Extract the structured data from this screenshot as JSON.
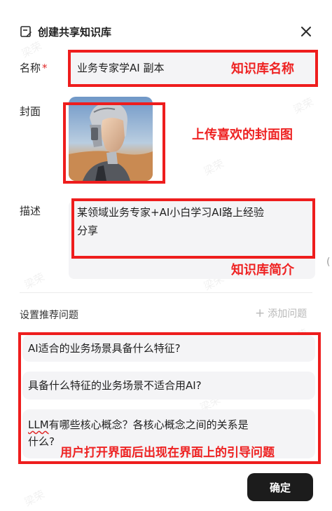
{
  "dialog": {
    "title": "创建共享知识库",
    "close_icon": "close-icon",
    "title_icon": "edit-document-icon"
  },
  "form": {
    "name_label": "名称",
    "required_mark": "*",
    "name_value": "业务专家学AI 副本",
    "cover_label": "封面",
    "description_label": "描述",
    "description_line1": "某领域业务专家+AI小白学习AI路上经验",
    "description_line2": "分享"
  },
  "suggestions": {
    "label": "设置推荐问题",
    "add_label": "添加问题",
    "items": [
      {
        "text": "AI适合的业务场景具备什么特征?"
      },
      {
        "text": "具备什么特征的业务场景不适合用AI?"
      },
      {
        "prefix": "LLM",
        "line1": "有哪些核心概念？各核心概念之间的关系是",
        "line2": "什么?"
      }
    ]
  },
  "confirm_label": "确定",
  "annotations": {
    "name": "知识库名称",
    "cover": "上传喜欢的封面图",
    "description": "知识库简介",
    "questions": "用户打开界面后出现在界面上的引导问题"
  },
  "watermark": "梁荣",
  "edge_mark": "(",
  "colors": {
    "annotation_red": "#ee1d1d",
    "input_bg": "#f4f4f6",
    "confirm_bg": "#1c1c1c"
  }
}
